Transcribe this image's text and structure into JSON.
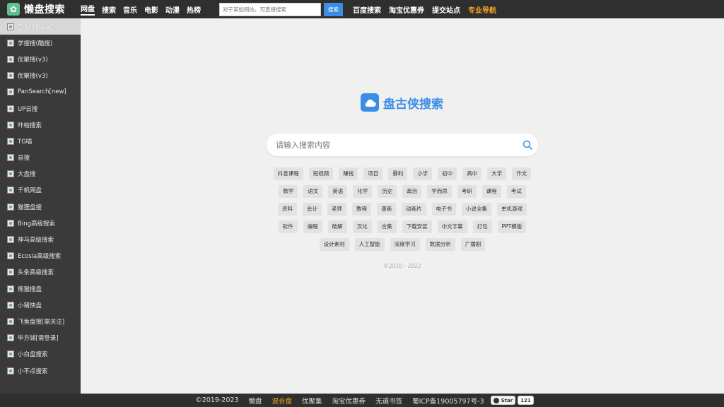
{
  "header": {
    "logo_text": "懒盘搜索",
    "nav": [
      "网盘",
      "搜索",
      "音乐",
      "电影",
      "动漫",
      "热榜"
    ],
    "search_placeholder": "对于某些网站，可直接搜索",
    "search_button": "搜索",
    "links": [
      "百度搜索",
      "淘宝优惠券",
      "提交站点",
      "专业导航"
    ]
  },
  "sidebar": {
    "items": [
      "盘古侠[new]",
      "学搜搜(酷搜)",
      "优聚搜(v3)",
      "优聚搜(v3)",
      "PanSearch[new]",
      "UP云搜",
      "咔帕搜索",
      "TG喵",
      "易搜",
      "大盘搜",
      "千帆网盘",
      "猫狸盘搜",
      "Bing高级搜索",
      "神马高级搜索",
      "Ecosia高级搜索",
      "头条高级搜索",
      "熊猫搜盘",
      "小猪快盘",
      "飞鱼盘搜[需关注]",
      "毕方铺[需登录]",
      "小白盘搜索",
      "小不点搜索"
    ]
  },
  "main": {
    "title": "盘古侠搜索",
    "search_placeholder": "请输入搜索内容",
    "tag_rows": [
      [
        "抖音课程",
        "短视频",
        "赚钱",
        "项目",
        "暴利",
        "小学",
        "初中",
        "高中",
        "大学",
        "作文"
      ],
      [
        "数学",
        "语文",
        "英语",
        "化学",
        "历史",
        "政治",
        "学而思",
        "考研",
        "课程",
        "考试"
      ],
      [
        "资料",
        "会计",
        "老师",
        "教程",
        "漫画",
        "动画片",
        "电子书",
        "小说全集",
        "单机游戏"
      ],
      [
        "软件",
        "编程",
        "破解",
        "汉化",
        "合集",
        "下载安装",
        "中文字幕",
        "打包",
        "PPT模版"
      ],
      [
        "设计素材",
        "人工智能",
        "深度学习",
        "数据分析",
        "广播剧"
      ]
    ],
    "copyright": "©2010 - 2022"
  },
  "footer": {
    "copyright": "©2019-2023",
    "links": [
      "懒盘",
      "混合盘",
      "优聚集",
      "淘宝优惠券",
      "无遁书签",
      "蜀ICP备19005797号-3"
    ],
    "star_label": "Star",
    "star_count": "121"
  },
  "colors": {
    "accent": "#3a8ee6",
    "gold": "#f5a623",
    "topbar": "#2f2f2f",
    "sidebar": "#3a3a3a"
  }
}
